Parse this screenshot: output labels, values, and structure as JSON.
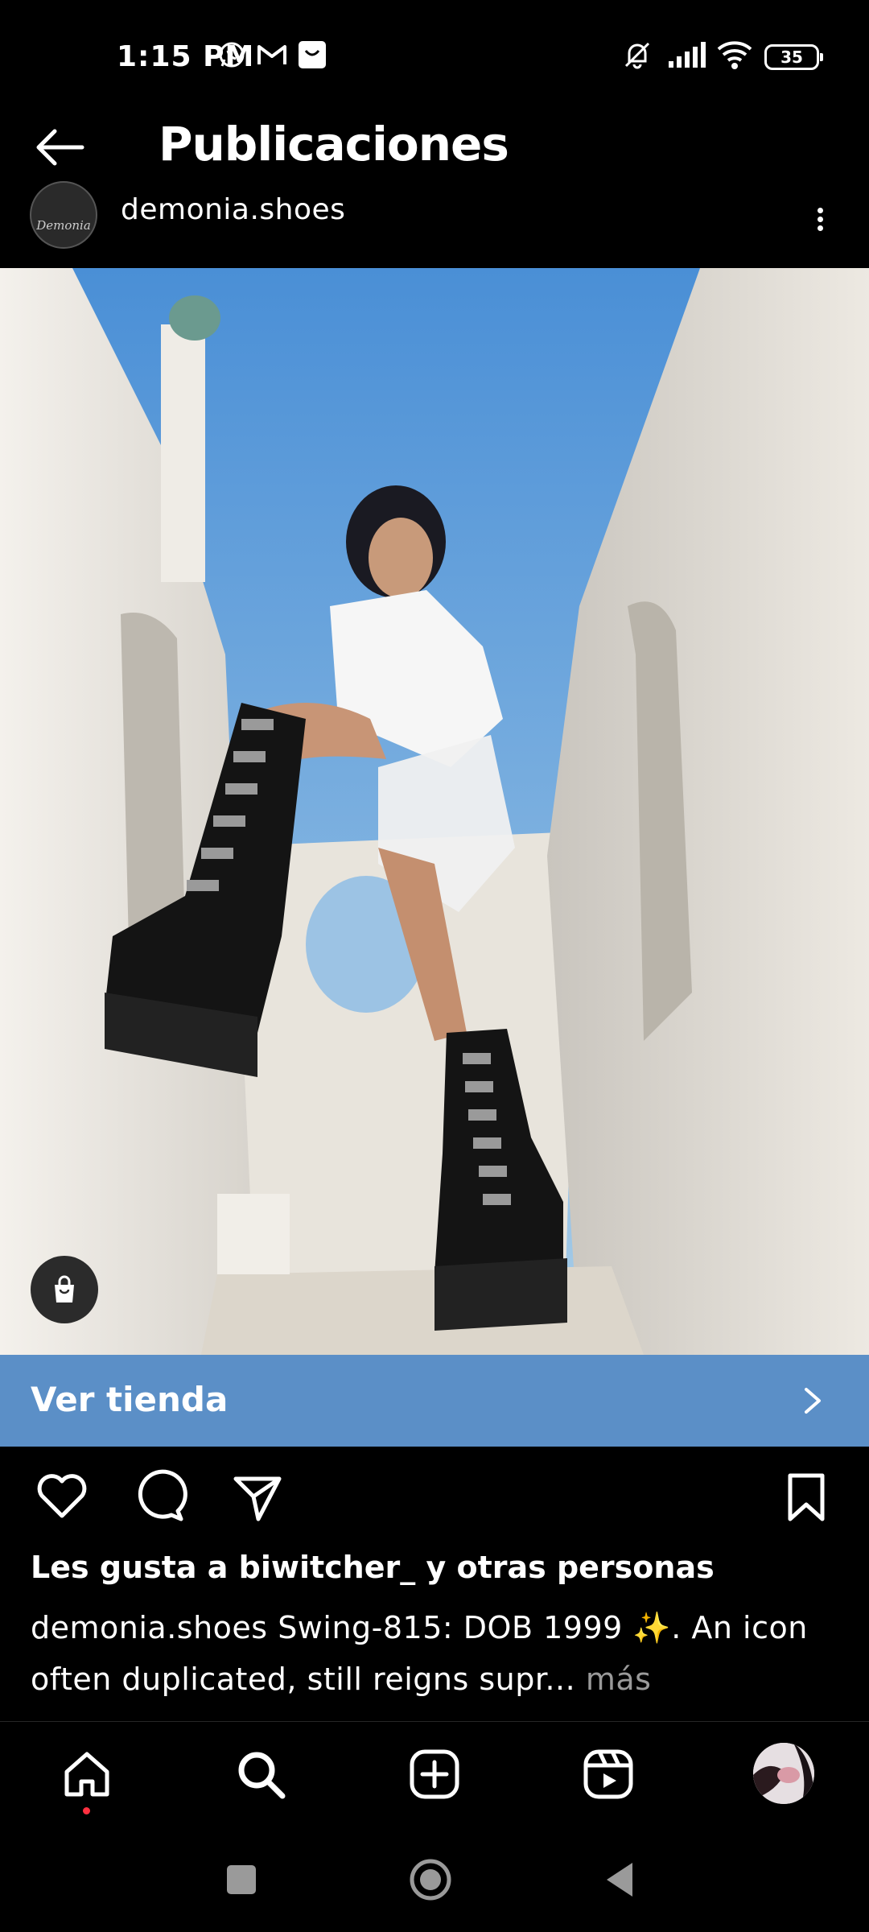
{
  "status_bar": {
    "time": "1:15 PM",
    "battery": "35",
    "left_icons": [
      "whatsapp-icon",
      "gmail-icon",
      "shop-notification-icon"
    ],
    "right_icons": [
      "mute-icon",
      "signal-icon",
      "wifi-icon",
      "battery-icon"
    ]
  },
  "header": {
    "title": "Publicaciones",
    "back_icon": "arrow-left-icon"
  },
  "post": {
    "username": "demonia.shoes",
    "avatar_text": "Demonia",
    "shop_banner": {
      "label": "Ver tienda"
    },
    "likes_text": "Les gusta a biwitcher_ y otras personas",
    "caption_username": "demonia.shoes",
    "caption_text": "Swing-815: DOB 1999 ✨. An icon often duplicated, still reigns supr...",
    "caption_more": "más"
  },
  "colors": {
    "background": "#000000",
    "shop_banner": "#5b8fc7",
    "home_notification_dot": "#ff3040",
    "muted_text": "#9a9a9a"
  },
  "bottom_nav": [
    "home-icon",
    "search-icon",
    "create-post-icon",
    "reels-icon",
    "profile-avatar"
  ]
}
